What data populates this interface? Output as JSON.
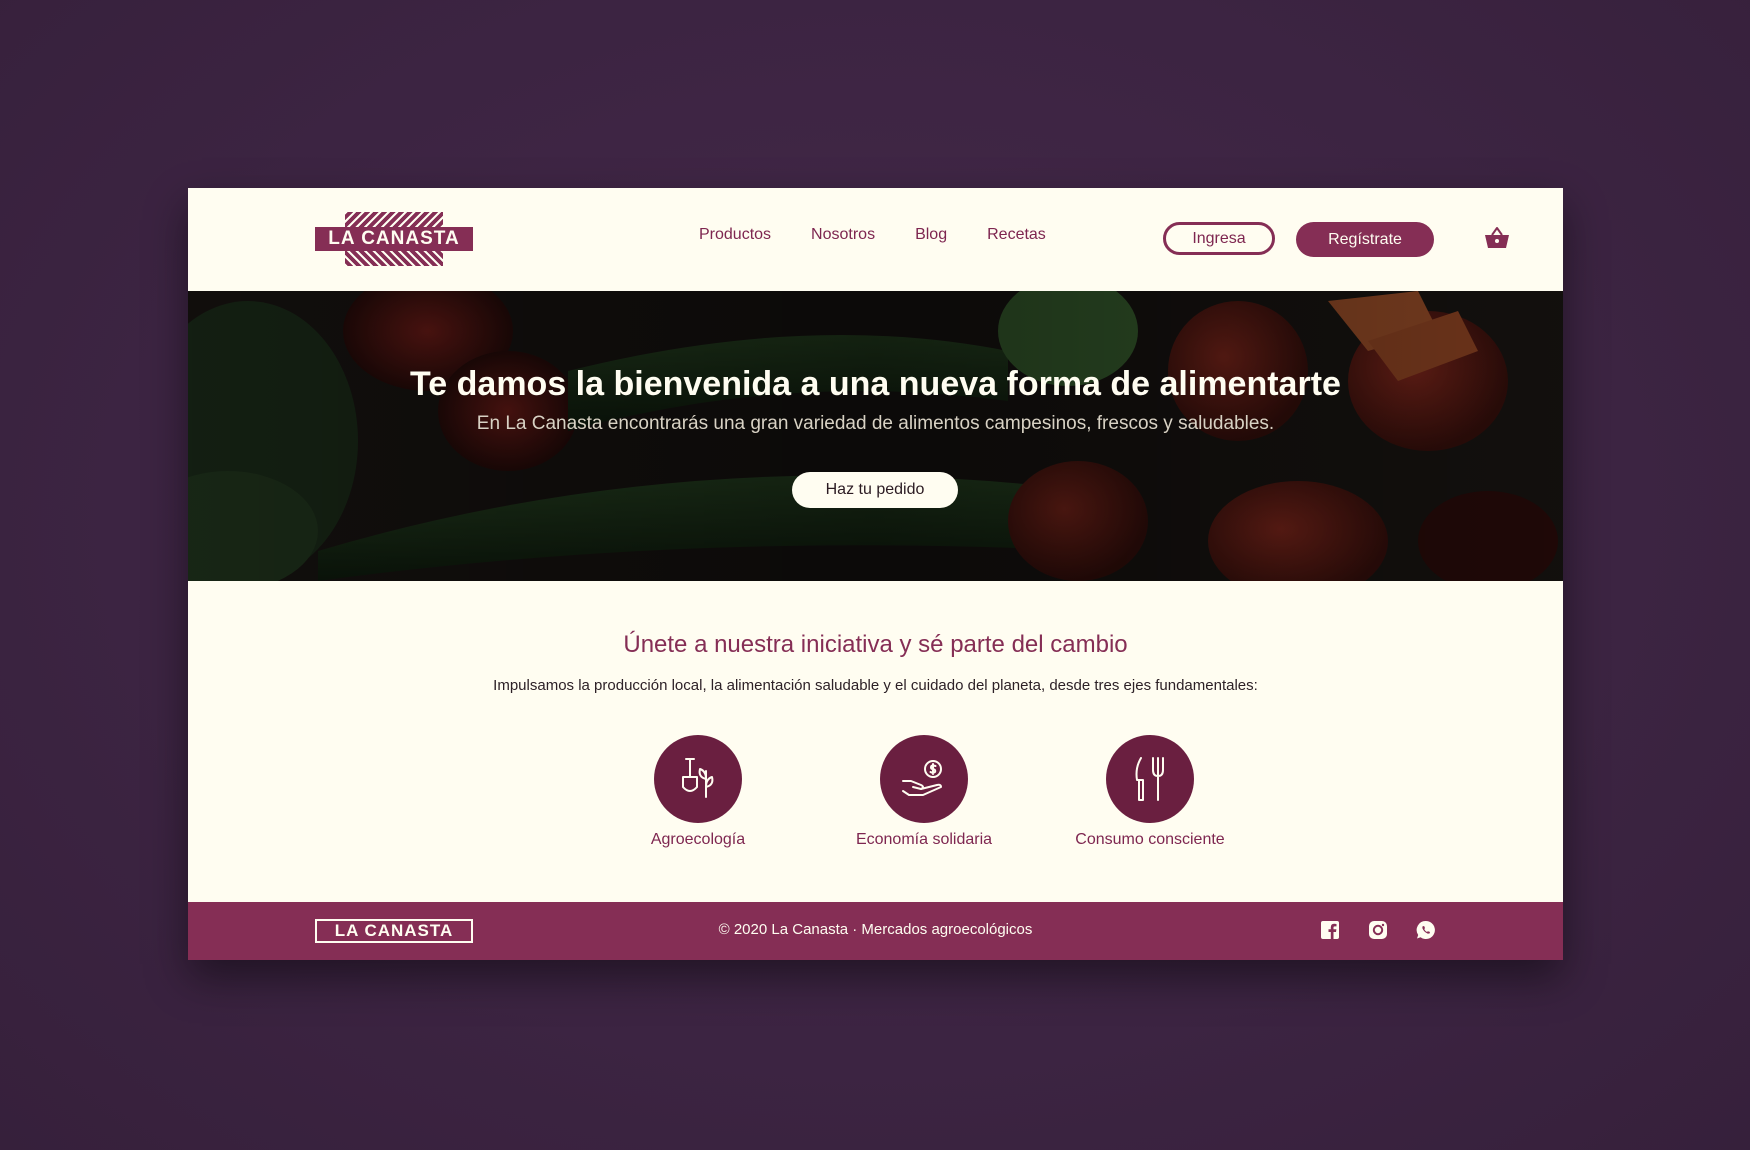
{
  "brand": {
    "name": "LA CANASTA"
  },
  "nav": {
    "items": [
      {
        "label": "Productos"
      },
      {
        "label": "Nosotros"
      },
      {
        "label": "Blog"
      },
      {
        "label": "Recetas"
      }
    ]
  },
  "auth": {
    "login_label": "Ingresa",
    "register_label": "Regístrate"
  },
  "hero": {
    "title": "Te damos la bienvenida a una nueva forma de alimentarte",
    "subtitle": "En La Canasta encontrarás una gran variedad de alimentos campesinos, frescos y saludables.",
    "cta_label": "Haz tu pedido"
  },
  "join": {
    "title": "Únete a nuestra iniciativa y sé parte del cambio",
    "text": "Impulsamos la producción local, la alimentación saludable y el cuidado del planeta, desde tres ejes fundamentales:",
    "pillars": [
      {
        "label": "Agroecología",
        "icon": "shovel-plant-icon"
      },
      {
        "label": "Economía solidaria",
        "icon": "hand-coin-icon"
      },
      {
        "label": "Consumo consciente",
        "icon": "fork-knife-icon"
      }
    ]
  },
  "footer": {
    "logo": "LA CANASTA",
    "copyright": "© 2020 La Canasta · Mercados agroecológicos",
    "social": [
      "facebook-icon",
      "instagram-icon",
      "whatsapp-icon"
    ]
  },
  "colors": {
    "brand": "#852e55",
    "brand_dark": "#6a1f40",
    "cream": "#fffdf1",
    "backdrop": "#3f2744"
  }
}
